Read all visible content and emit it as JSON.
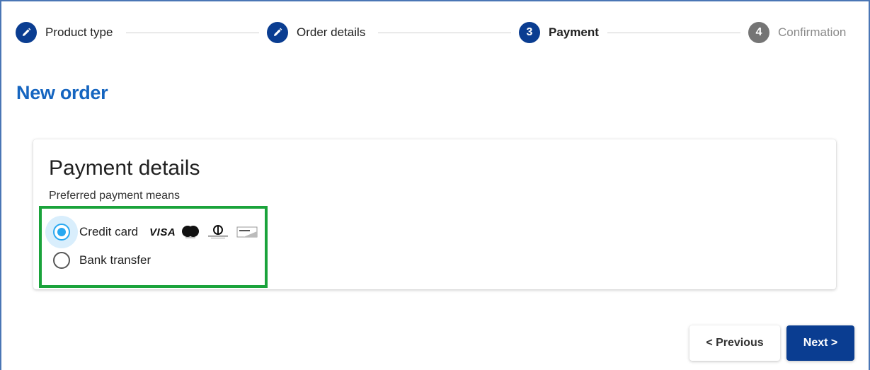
{
  "stepper": {
    "steps": [
      {
        "label": "Product type",
        "state": "done",
        "icon": "pencil-icon"
      },
      {
        "label": "Order details",
        "state": "done",
        "icon": "pencil-icon"
      },
      {
        "label": "Payment",
        "state": "active",
        "number": "3"
      },
      {
        "label": "Confirmation",
        "state": "pending",
        "number": "4"
      }
    ]
  },
  "page": {
    "title": "New order"
  },
  "payment": {
    "title": "Payment details",
    "subtitle": "Preferred payment means",
    "options": [
      {
        "label": "Credit card",
        "selected": true,
        "logos": [
          "VISA",
          "mastercard-icon",
          "diners-club-icon",
          "discover-icon"
        ]
      },
      {
        "label": "Bank transfer",
        "selected": false
      }
    ]
  },
  "buttons": {
    "previous": "< Previous",
    "next": "Next >"
  },
  "colors": {
    "primary": "#0a3d91",
    "title_blue": "#1565c0",
    "radio_selected": "#29a8f0",
    "highlight": "#1aa33b",
    "pending": "#757575"
  }
}
